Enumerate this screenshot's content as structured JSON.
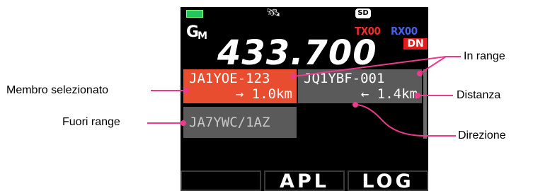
{
  "status_bar": {
    "battery_icon": "battery-icon",
    "gps_icon": "gps-satellite-icon",
    "sd_label": "SD"
  },
  "header": {
    "group_mode": "G",
    "group_mode_sub": "M",
    "tx_label": "TX00",
    "rx_label": "RX00",
    "mode_badge": "DN",
    "frequency": "433.700"
  },
  "members": [
    {
      "callsign": "JA1YOE-123",
      "direction": "→",
      "distance": "1.0km",
      "state": "selected"
    },
    {
      "callsign": "JQ1YBF-001",
      "direction": "←",
      "distance": "1.4km",
      "state": "in range"
    },
    {
      "callsign": "JA7YWC/1AZ",
      "direction": "",
      "distance": "",
      "state": "out of range"
    }
  ],
  "softkeys": [
    "",
    "APL",
    "LOG"
  ],
  "callouts": {
    "selected_member": "Membro selezionato",
    "out_of_range": "Fuori range",
    "in_range": "In range",
    "distance": "Distanza",
    "direction": "Direzione"
  },
  "colors": {
    "callout_line": "#ee3a8c",
    "selected_bg": "#e84d2f",
    "cell_bg": "#5a5a5a",
    "tx_red": "#ef2b2b",
    "rx_blue": "#4561e8",
    "battery_green": "#22c55e"
  }
}
